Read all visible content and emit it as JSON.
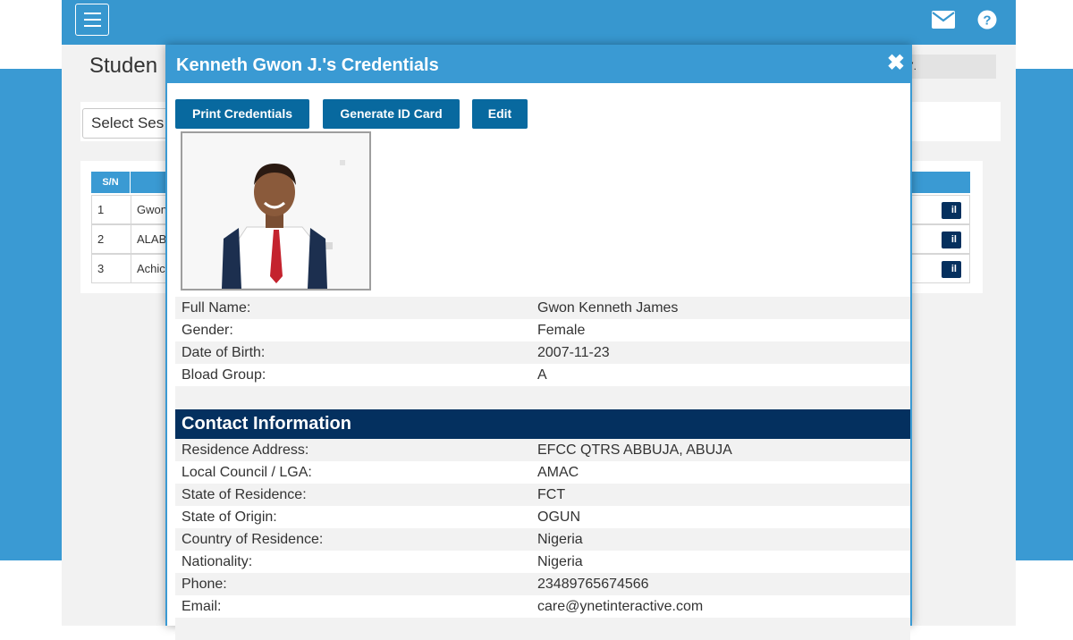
{
  "page": {
    "title": "Studen",
    "breadcrumb": "7.",
    "session_select": "Select Ses"
  },
  "table": {
    "sn_header": "S/N",
    "rows": [
      {
        "sn": "1",
        "name": "Gwon",
        "action": "il"
      },
      {
        "sn": "2",
        "name": "ALAB",
        "action": "il"
      },
      {
        "sn": "3",
        "name": "Achic",
        "action": "il"
      }
    ]
  },
  "modal": {
    "title": "Kenneth Gwon J.'s Credentials",
    "close": "✖",
    "buttons": {
      "print": "Print Credentials",
      "id_card": "Generate ID Card",
      "edit": "Edit"
    },
    "personal": [
      {
        "label": "Full Name:",
        "value": "Gwon Kenneth James"
      },
      {
        "label": "Gender:",
        "value": "Female"
      },
      {
        "label": "Date of Birth:",
        "value": "2007-11-23"
      },
      {
        "label": "Bload Group:",
        "value": "A"
      }
    ],
    "contact_heading": "Contact Information",
    "contact": [
      {
        "label": "Residence Address:",
        "value": "EFCC QTRS ABBUJA, ABUJA"
      },
      {
        "label": "Local Council / LGA:",
        "value": "AMAC"
      },
      {
        "label": "State of Residence:",
        "value": "FCT"
      },
      {
        "label": "State of Origin:",
        "value": "OGUN"
      },
      {
        "label": "Country of Residence:",
        "value": "Nigeria"
      },
      {
        "label": "Nationality:",
        "value": "Nigeria"
      },
      {
        "label": "Phone:",
        "value": "23489765674566"
      },
      {
        "label": "Email:",
        "value": "care@ynetinteractive.com"
      }
    ]
  },
  "icons": {
    "menu": "hamburger-icon",
    "mail": "envelope-icon",
    "help": "question-circle-icon"
  },
  "colors": {
    "primary": "#3a9ad3",
    "button": "#08699f",
    "section": "#04305f"
  }
}
